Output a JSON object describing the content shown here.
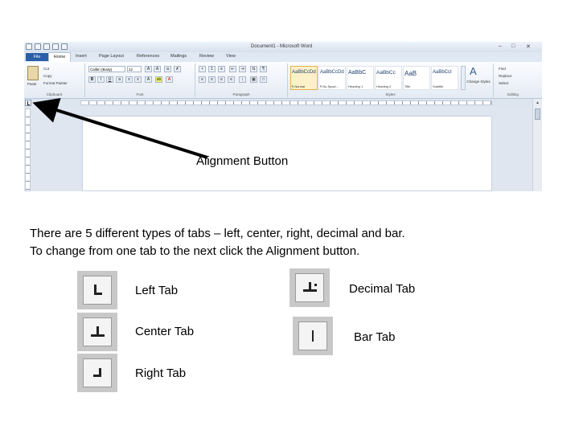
{
  "word_window": {
    "title": "Document1 - Microsoft Word",
    "file_tab": "File",
    "ribbon_tabs": [
      "Home",
      "Insert",
      "Page Layout",
      "References",
      "Mailings",
      "Review",
      "View"
    ],
    "clipboard": {
      "paste": "Paste",
      "cut": "Cut",
      "copy": "Copy",
      "format_painter": "Format Painter",
      "label": "Clipboard"
    },
    "font": {
      "name": "Calibri (Body)",
      "size": "12",
      "label": "Font"
    },
    "paragraph": {
      "label": "Paragraph"
    },
    "styles": {
      "label": "Styles",
      "items": [
        {
          "sample": "AaBbCcDd",
          "name": "¶ Normal"
        },
        {
          "sample": "AaBbCcDd",
          "name": "¶ No Spaci..."
        },
        {
          "sample": "AaBbC",
          "name": "Heading 1"
        },
        {
          "sample": "AaBbCc",
          "name": "Heading 2"
        },
        {
          "sample": "AaB",
          "name": "Title"
        },
        {
          "sample": "AaBbCcI",
          "name": "Subtitle"
        }
      ],
      "change_styles": "Change Styles"
    },
    "editing": {
      "find": "Find",
      "replace": "Replace",
      "select": "Select",
      "label": "Editing"
    }
  },
  "annotation": {
    "caption": "Alignment Button"
  },
  "description": {
    "line1": "There are 5 different types of tabs – left, center, right, decimal and bar.",
    "line2": "To change from one tab to the next click the Alignment button."
  },
  "tabs": {
    "left": "Left Tab",
    "center": "Center Tab",
    "right": "Right Tab",
    "decimal": "Decimal Tab",
    "bar": "Bar Tab"
  }
}
